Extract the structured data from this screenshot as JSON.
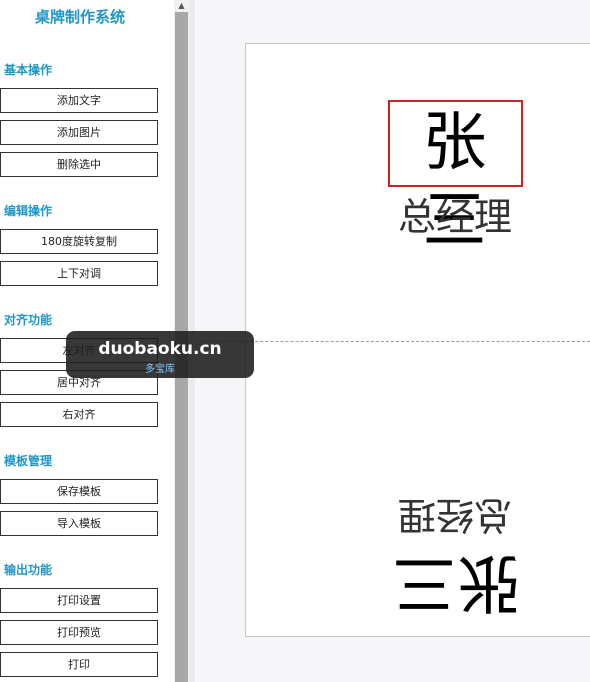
{
  "app": {
    "title": "桌牌制作系统"
  },
  "sections": {
    "basic": {
      "title": "基本操作",
      "add_text": "添加文字",
      "add_image": "添加图片",
      "delete_selected": "删除选中"
    },
    "edit": {
      "title": "编辑操作",
      "rotate_copy": "180度旋转复制",
      "swap_vertical": "上下对调"
    },
    "align": {
      "title": "对齐功能",
      "left": "左对齐",
      "center": "居中对齐",
      "right": "右对齐"
    },
    "template": {
      "title": "模板管理",
      "save": "保存模板",
      "import": "导入模板"
    },
    "output": {
      "title": "输出功能",
      "print_settings": "打印设置",
      "print_preview": "打印预览",
      "print": "打印"
    }
  },
  "card": {
    "name": "张三",
    "position": "总经理"
  },
  "watermark": {
    "main": "duobaoku.cn",
    "sub": "多宝库"
  },
  "colors": {
    "accent": "#2196c8",
    "selection": "#cc2222"
  },
  "icons": {
    "scroll_up": "scroll-up-arrow"
  }
}
